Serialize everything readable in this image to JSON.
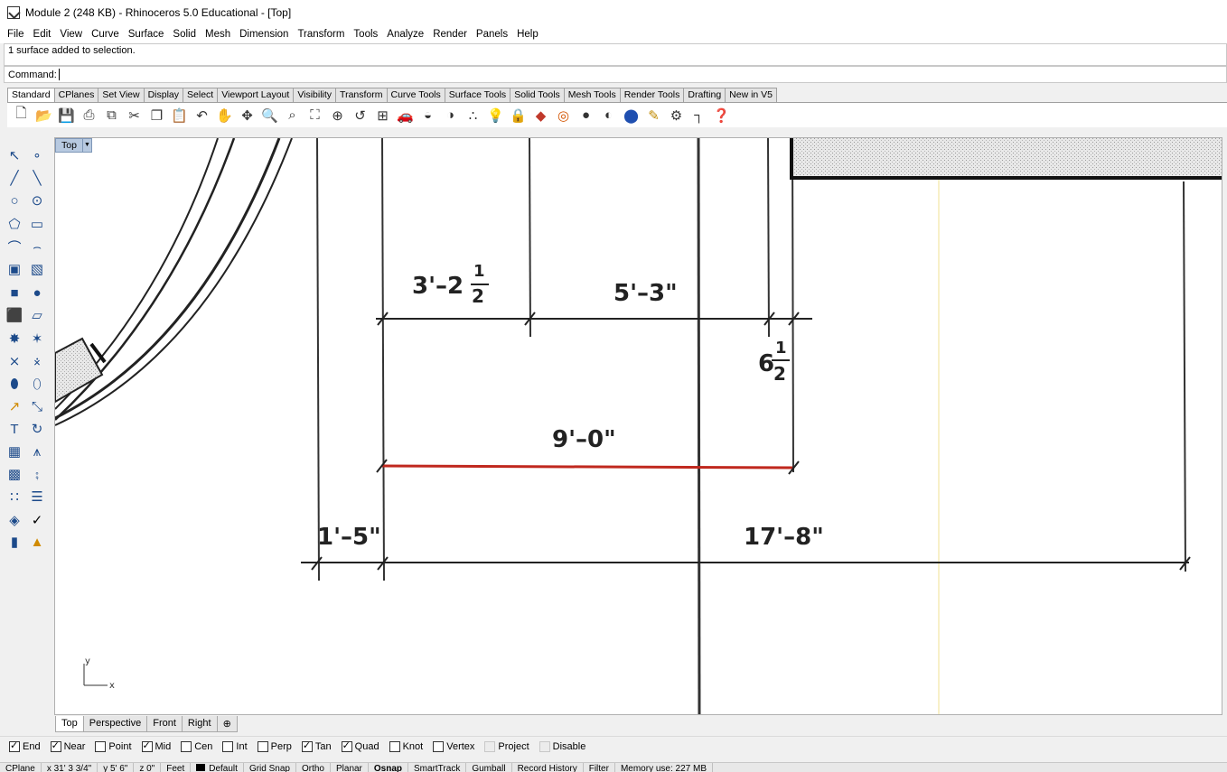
{
  "window": {
    "title": "Module 2 (248 KB) - Rhinoceros 5.0 Educational - [Top]"
  },
  "menu": [
    "File",
    "Edit",
    "View",
    "Curve",
    "Surface",
    "Solid",
    "Mesh",
    "Dimension",
    "Transform",
    "Tools",
    "Analyze",
    "Render",
    "Panels",
    "Help"
  ],
  "command": {
    "history": "1 surface added to selection.",
    "prompt": "Command:",
    "value": ""
  },
  "toolbar_tabs": [
    "Standard",
    "CPlanes",
    "Set View",
    "Display",
    "Select",
    "Viewport Layout",
    "Visibility",
    "Transform",
    "Curve Tools",
    "Surface Tools",
    "Solid Tools",
    "Mesh Tools",
    "Render Tools",
    "Drafting",
    "New in V5"
  ],
  "active_toolbar_tab": "Standard",
  "standard_tools": [
    "new-file-icon",
    "open-icon",
    "save-icon",
    "print-icon",
    "import-icon",
    "cut-icon",
    "copy-icon",
    "paste-icon",
    "undo-icon",
    "pan-icon",
    "rotate-view-icon",
    "zoom-icon",
    "zoom-window-icon",
    "zoom-extents-icon",
    "zoom-selected-icon",
    "undo-view-icon",
    "four-viewports-icon",
    "car-icon",
    "ghosted-icon",
    "rendered-icon",
    "select-points-icon",
    "light-icon",
    "lock-icon",
    "layer-icon",
    "color-wheel-icon",
    "render-sphere-icon",
    "render-shaded-icon",
    "render-blue-icon",
    "pencil-icon",
    "settings-gear-icon",
    "dimension-icon",
    "help-icon"
  ],
  "viewport": {
    "name": "Top",
    "axis_x": "x",
    "axis_y": "y",
    "dimensions": [
      "3'–2",
      "1",
      "2",
      "5'–3\"",
      "6",
      "1",
      "2",
      "9'–0\"",
      "1'–5\"",
      "17'–8\""
    ],
    "highlight_color": "#c0281e"
  },
  "view_tabs": [
    "Top",
    "Perspective",
    "Front",
    "Right"
  ],
  "active_view_tab": "Top",
  "osnaps": [
    {
      "label": "End",
      "checked": true
    },
    {
      "label": "Near",
      "checked": true
    },
    {
      "label": "Point",
      "checked": false
    },
    {
      "label": "Mid",
      "checked": true
    },
    {
      "label": "Cen",
      "checked": false
    },
    {
      "label": "Int",
      "checked": false
    },
    {
      "label": "Perp",
      "checked": false
    },
    {
      "label": "Tan",
      "checked": true
    },
    {
      "label": "Quad",
      "checked": true
    },
    {
      "label": "Knot",
      "checked": false
    },
    {
      "label": "Vertex",
      "checked": false
    },
    {
      "label": "Project",
      "checked": false,
      "disabled": true
    },
    {
      "label": "Disable",
      "checked": false,
      "disabled": true
    }
  ],
  "status": {
    "cplane": "CPlane",
    "x": "x 31' 3 3/4\"",
    "y": "y 5' 6\"",
    "z": "z 0\"",
    "units": "Feet",
    "layer": "Default",
    "toggles": [
      "Grid Snap",
      "Ortho",
      "Planar",
      "Osnap",
      "SmartTrack",
      "Gumball",
      "Record History",
      "Filter"
    ],
    "active_toggle": "Osnap",
    "memory": "Memory use: 227 MB"
  }
}
